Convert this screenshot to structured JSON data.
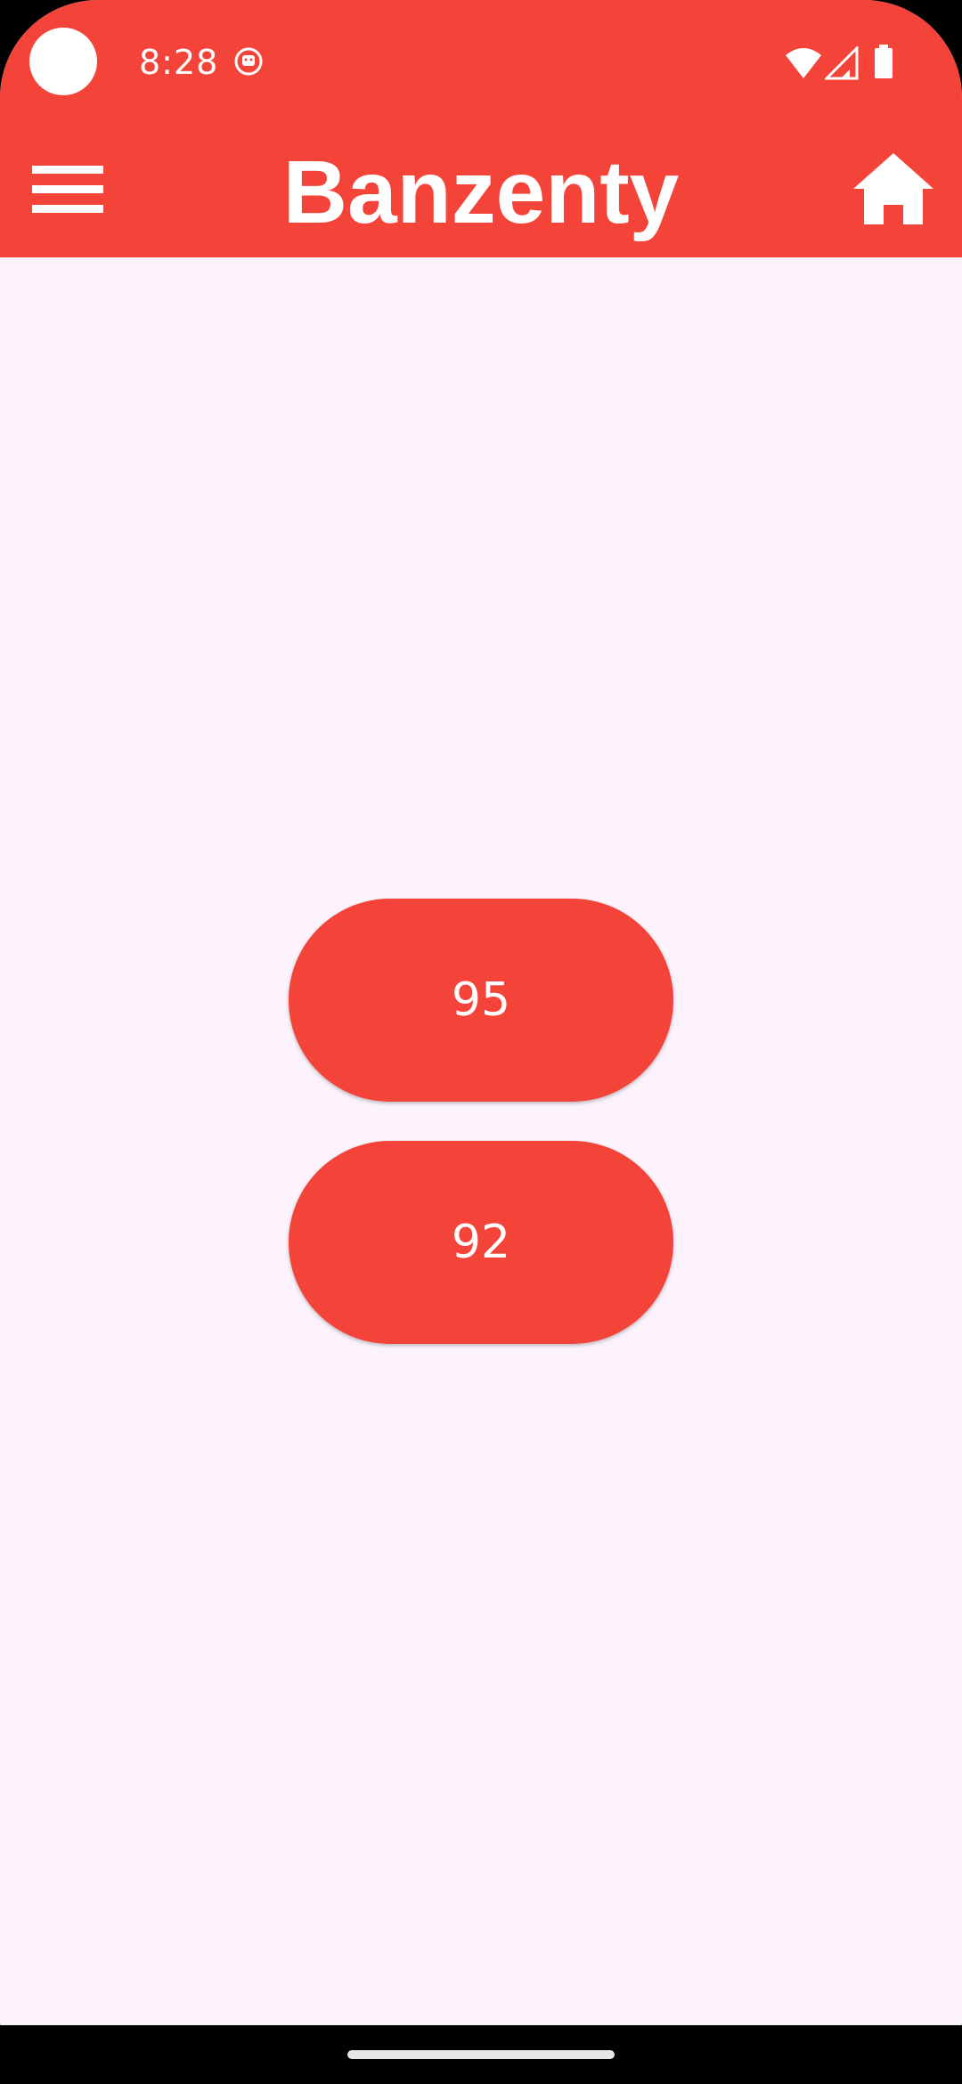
{
  "status_bar": {
    "time": "8:28",
    "icons": [
      "camera-dot",
      "notification-icon",
      "wifi-icon",
      "signal-icon",
      "battery-icon"
    ]
  },
  "toolbar": {
    "title": "Banzenty",
    "menu_icon": "hamburger-menu-icon",
    "home_icon": "home-icon"
  },
  "options": [
    {
      "label": "95"
    },
    {
      "label": "92"
    }
  ],
  "colors": {
    "primary": "#f4443a",
    "background": "#fcf3fc",
    "on_primary": "#ffffff"
  }
}
